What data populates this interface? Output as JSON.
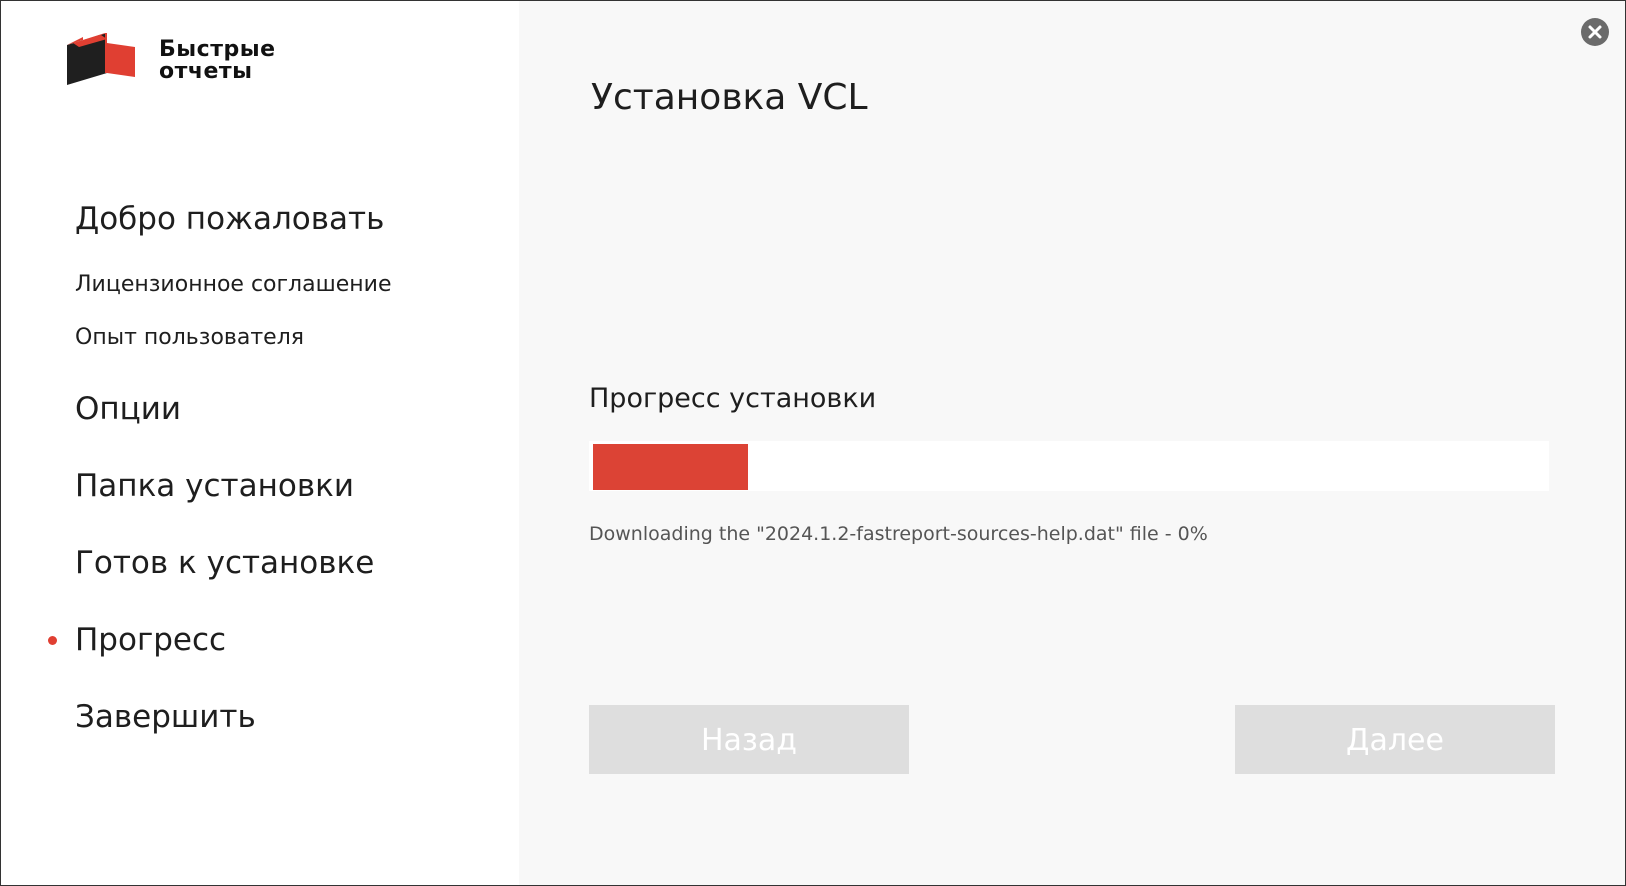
{
  "logo": {
    "line1": "Быстрые",
    "line2": "отчеты",
    "icon": "red-black-cube-logo",
    "colors": {
      "red": "#e03f32",
      "dark": "#1f1f1f"
    }
  },
  "sidebar": {
    "items": [
      {
        "label": "Добро пожаловать",
        "size": "big"
      },
      {
        "label": "Лицензионное соглашение",
        "size": "small"
      },
      {
        "label": "Опыт пользователя",
        "size": "small"
      },
      {
        "label": "Опции",
        "size": "big"
      },
      {
        "label": "Папка установки",
        "size": "big"
      },
      {
        "label": "Готов к установке",
        "size": "big"
      },
      {
        "label": "Прогресс",
        "size": "big",
        "active": true
      },
      {
        "label": "Завершить",
        "size": "big"
      }
    ],
    "active_indicator_color": "#e03f32"
  },
  "window": {
    "close_icon": "close-icon"
  },
  "main": {
    "title": "Установка VCL",
    "progress_label": "Прогресс установки",
    "progress_value": 0.163,
    "progress_color": "#dc4335",
    "status": "Downloading the \"2024.1.2-fastreport-sources-help.dat\" file - 0%",
    "back_label": "Назад",
    "next_label": "Далее"
  }
}
